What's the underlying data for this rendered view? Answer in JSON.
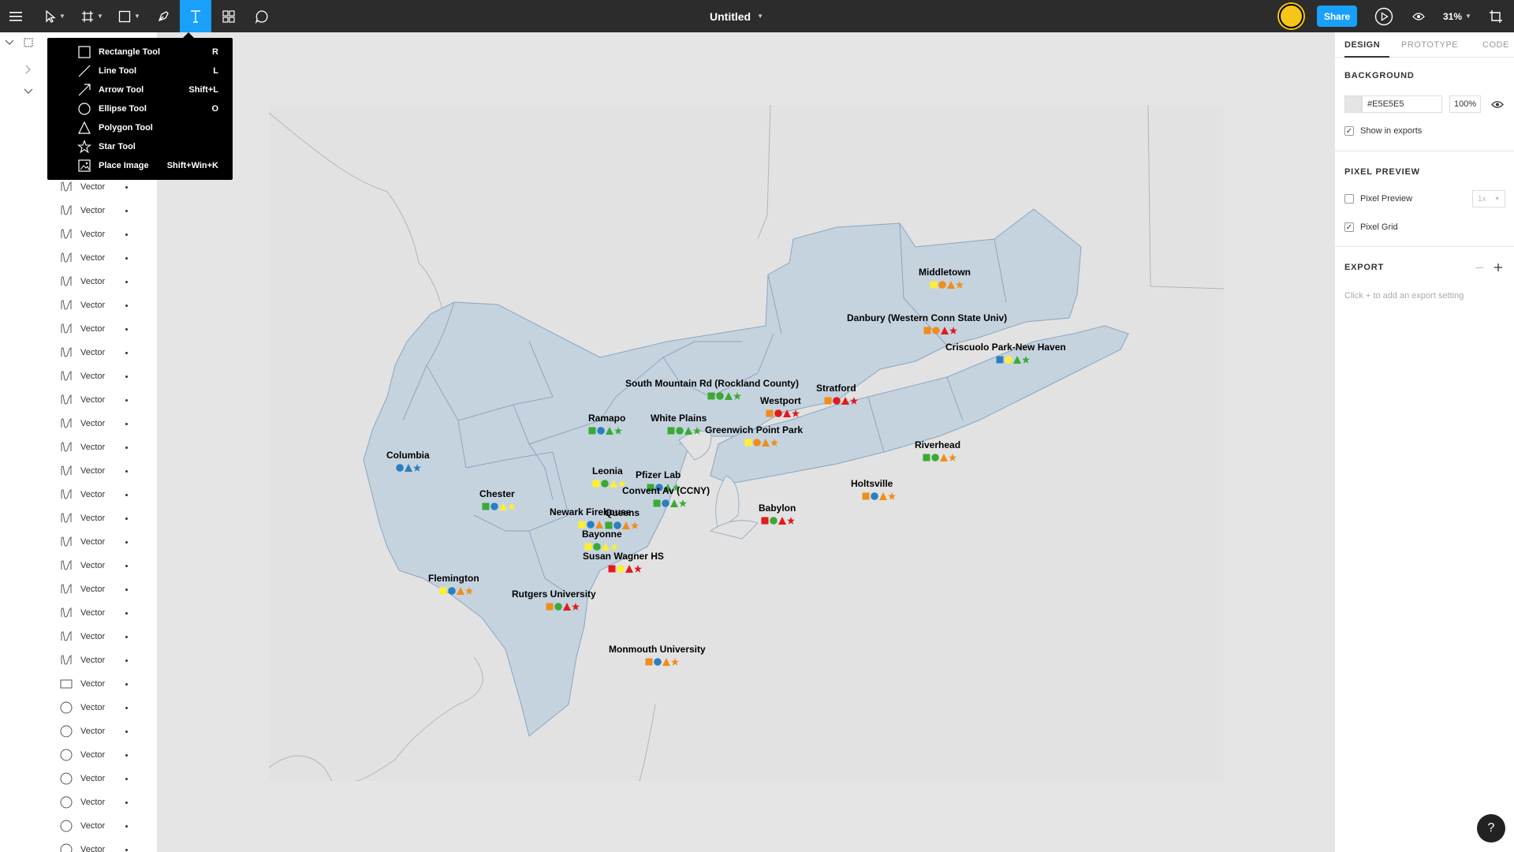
{
  "topbar": {
    "title": "Untitled",
    "share_label": "Share",
    "zoom": "31%"
  },
  "dropdown": {
    "items": [
      {
        "label": "Rectangle Tool",
        "shortcut": "R",
        "icon": "rectangle-icon"
      },
      {
        "label": "Line Tool",
        "shortcut": "L",
        "icon": "line-icon"
      },
      {
        "label": "Arrow Tool",
        "shortcut": "Shift+L",
        "icon": "arrow-icon"
      },
      {
        "label": "Ellipse Tool",
        "shortcut": "O",
        "icon": "ellipse-icon"
      },
      {
        "label": "Polygon Tool",
        "shortcut": "",
        "icon": "polygon-icon"
      },
      {
        "label": "Star Tool",
        "shortcut": "",
        "icon": "star-icon"
      },
      {
        "label": "Place Image",
        "shortcut": "Shift+Win+K",
        "icon": "image-icon"
      }
    ]
  },
  "layers": {
    "vector_label": "Vector",
    "rows": [
      {
        "icon": "vector-icon"
      },
      {
        "icon": "vector-icon"
      },
      {
        "icon": "vector-icon"
      },
      {
        "icon": "vector-icon"
      },
      {
        "icon": "vector-icon"
      },
      {
        "icon": "vector-icon"
      },
      {
        "icon": "vector-icon"
      },
      {
        "icon": "vector-icon"
      },
      {
        "icon": "vector-icon"
      },
      {
        "icon": "vector-icon"
      },
      {
        "icon": "vector-icon"
      },
      {
        "icon": "vector-icon"
      },
      {
        "icon": "vector-icon"
      },
      {
        "icon": "vector-icon"
      },
      {
        "icon": "vector-icon"
      },
      {
        "icon": "vector-icon"
      },
      {
        "icon": "vector-icon"
      },
      {
        "icon": "vector-icon"
      },
      {
        "icon": "vector-icon"
      },
      {
        "icon": "vector-icon"
      },
      {
        "icon": "vector-icon"
      },
      {
        "icon": "rectangle-icon"
      },
      {
        "icon": "ellipse-icon"
      },
      {
        "icon": "ellipse-icon"
      },
      {
        "icon": "ellipse-icon"
      },
      {
        "icon": "ellipse-icon"
      },
      {
        "icon": "ellipse-icon"
      },
      {
        "icon": "ellipse-icon"
      },
      {
        "icon": "ellipse-icon"
      }
    ]
  },
  "map": {
    "colors": {
      "green": "#3aaa35",
      "blue": "#2a7fc1",
      "yellow": "#ffee33",
      "orange": "#f28c1b",
      "red": "#e31a1c",
      "land": "#c5d3df",
      "border": "#8aa6c0"
    },
    "stations": [
      {
        "name": "Middletown",
        "symbols": [
          "yellow-square",
          "orange-circle",
          "orange-triangle",
          "orange-star"
        ]
      },
      {
        "name": "Danbury (Western Conn State Univ)",
        "symbols": [
          "orange-square",
          "orange-circle",
          "red-triangle",
          "red-star"
        ]
      },
      {
        "name": "Criscuolo Park-New Haven",
        "symbols": [
          "blue-square",
          "yellow-circle",
          "green-triangle",
          "green-star"
        ]
      },
      {
        "name": "South Mountain Rd (Rockland County)",
        "symbols": [
          "green-square",
          "green-circle",
          "green-triangle",
          "green-star"
        ]
      },
      {
        "name": "Stratford",
        "symbols": [
          "orange-square",
          "red-circle",
          "red-triangle",
          "red-star"
        ]
      },
      {
        "name": "Westport",
        "symbols": [
          "orange-square",
          "red-circle",
          "red-triangle",
          "red-star"
        ]
      },
      {
        "name": "Ramapo",
        "symbols": [
          "green-square",
          "blue-circle",
          "green-triangle",
          "green-star"
        ]
      },
      {
        "name": "White Plains",
        "symbols": [
          "green-square",
          "green-circle",
          "green-triangle",
          "green-star"
        ]
      },
      {
        "name": "Greenwich Point Park",
        "symbols": [
          "yellow-square",
          "orange-circle",
          "orange-triangle",
          "orange-star"
        ]
      },
      {
        "name": "Riverhead",
        "symbols": [
          "green-square",
          "green-circle",
          "orange-triangle",
          "orange-star"
        ]
      },
      {
        "name": "Columbia",
        "symbols": [
          "blue-circle",
          "blue-triangle",
          "blue-star"
        ]
      },
      {
        "name": "Leonia",
        "symbols": [
          "yellow-square",
          "green-circle",
          "yellow-triangle",
          "yellow-star"
        ]
      },
      {
        "name": "Pfizer Lab",
        "symbols": [
          "green-square",
          "blue-circle",
          "green-triangle",
          "green-star"
        ]
      },
      {
        "name": "Holtsville",
        "symbols": [
          "orange-square",
          "blue-circle",
          "orange-triangle",
          "orange-star"
        ]
      },
      {
        "name": "Convent Av (CCNY)",
        "symbols": [
          "green-square",
          "blue-circle",
          "green-triangle",
          "green-star"
        ]
      },
      {
        "name": "Chester",
        "symbols": [
          "green-square",
          "blue-circle",
          "yellow-triangle",
          "yellow-star"
        ]
      },
      {
        "name": "Babylon",
        "symbols": [
          "red-square",
          "green-circle",
          "red-triangle",
          "red-star"
        ]
      },
      {
        "name": "Newark Firehouse",
        "symbols": [
          "yellow-square",
          "blue-circle",
          "orange-triangle",
          "orange-star"
        ]
      },
      {
        "name": "Queens",
        "symbols": [
          "green-square",
          "blue-circle",
          "orange-triangle",
          "orange-star"
        ]
      },
      {
        "name": "Bayonne",
        "symbols": [
          "yellow-square",
          "green-circle",
          "yellow-triangle",
          "yellow-star"
        ]
      },
      {
        "name": "Susan Wagner HS",
        "symbols": [
          "red-square",
          "yellow-circle",
          "red-triangle",
          "red-star"
        ]
      },
      {
        "name": "Flemington",
        "symbols": [
          "yellow-square",
          "blue-circle",
          "orange-triangle",
          "orange-star"
        ]
      },
      {
        "name": "Rutgers University",
        "symbols": [
          "orange-square",
          "green-circle",
          "red-triangle",
          "red-star"
        ]
      },
      {
        "name": "Monmouth University",
        "symbols": [
          "orange-square",
          "blue-circle",
          "orange-triangle",
          "orange-star"
        ]
      }
    ]
  },
  "rightpanel": {
    "tabs": [
      "DESIGN",
      "PROTOTYPE",
      "CODE"
    ],
    "background_title": "BACKGROUND",
    "bg_hex": "#E5E5E5",
    "bg_opacity": "100%",
    "show_in_exports": "Show in exports",
    "pixel_preview_title": "PIXEL PREVIEW",
    "pixel_preview_label": "Pixel Preview",
    "pixel_preview_scale": "1x",
    "pixel_grid_label": "Pixel Grid",
    "export_title": "EXPORT",
    "export_hint": "Click + to add an export setting"
  },
  "help_label": "?"
}
